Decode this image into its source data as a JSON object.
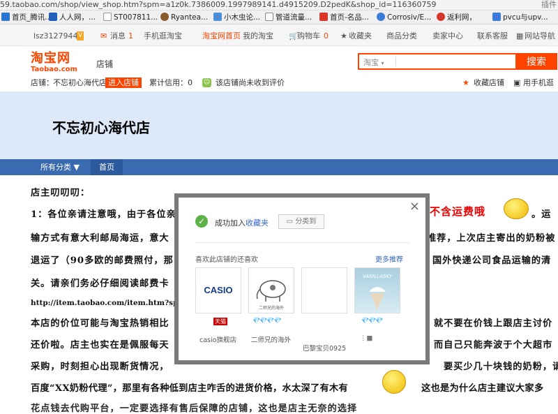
{
  "browser": {
    "url": "59.taobao.com/shop/view_shop.htm?spm=a1z0k.7386009.1997989141.d4915209.D2pedK&shop_id=116360759",
    "right_label": "插件"
  },
  "bookmarks": [
    {
      "label": "首页_腾讯...",
      "color": "#2e77d0"
    },
    {
      "label": "人人网，...",
      "color": "#1f5fb8"
    },
    {
      "label": "ST007811...",
      "color": "#999999"
    },
    {
      "label": "Ryantea...",
      "color": "#8b5a2b"
    },
    {
      "label": "小木虫论...",
      "color": "#4a8fd6"
    },
    {
      "label": "管道流量...",
      "color": "#888888"
    },
    {
      "label": "首页-名品...",
      "color": "#d9362b"
    },
    {
      "label": "Corrosiv/E...",
      "color": "#3a7bd5"
    },
    {
      "label": "返利网，",
      "color": "#d9362b"
    },
    {
      "label": "pvcu与upv...",
      "color": "#3a7bd5"
    }
  ],
  "topbar": {
    "username": "lsz31279447",
    "vip": "V",
    "messages": "消息",
    "msg_count": "1",
    "mobile": "手机逛淘宝",
    "home": "淘宝网首页",
    "my_taobao": "我的淘宝",
    "cart": "购物车",
    "cart_count": "0",
    "favorites": "收藏夹",
    "categories": "商品分类",
    "seller": "卖家中心",
    "service": "联系客服",
    "sitemap": "网站导航"
  },
  "header": {
    "logo_cn": "淘宝网",
    "logo_en": "Taobao.com",
    "shop_label": "店铺",
    "search_scope": "淘宝",
    "search_button": "搜索"
  },
  "shoprow": {
    "shop_prefix": "店铺：",
    "shop_name": "不忘初心海代店",
    "enter_shop": "进入店铺",
    "credit": "累计信用：0",
    "no_reviews": "该店铺尚未收到评价",
    "fav_shop": "收藏店铺",
    "mobile_shop": "用手机逛"
  },
  "banner": {
    "title": "不忘初心海代店"
  },
  "nav": {
    "all_categories": "所有分类",
    "home": "首页"
  },
  "content": {
    "line1": "店主叨叨叨：",
    "line2a": "1：各位亲请注意哦，由于各位亲",
    "line2_red": "不含运费哦",
    "line2b": "。运",
    "line3a": "输方式有意大利邮局海运，意大",
    "line3b": "推荐，上次店主寄出的奶粉被",
    "line4a": "退运了（90多欧的邮费照付，那",
    "line4b": "国外快递公司食品运输的清",
    "line5": "关。请亲们务必仔细阅读邮费卡",
    "line6": "http://item.taobao.com/item.htm?spm",
    "line7a": "本店的价位可能与淘宝热销相比",
    "line7b": "就不要在价钱上跟店主讨价",
    "line8a": "还价啦。店主也实在是佩服每天",
    "line8b": "而自己只能奔波于个大超市",
    "line9a": "采购，时刻担心出现断货情况，",
    "line9b": "要买少几十块钱的奶粉，请",
    "line10a": "百度“XX奶粉代理”，那里有各种低到店主咋舌的进货价格，水太深了有木有",
    "line10b": "这也是为什么店主建议大家多",
    "line11": "花点钱去代购平台，一定要选择有售后保障的店铺，这也是店主无奈的选择"
  },
  "modal": {
    "close": "×",
    "success_prefix": "成功加入",
    "success_link": "收藏夹",
    "category_btn": "分类到",
    "also_like": "喜欢此店铺的还喜欢",
    "more": "更多推荐",
    "shops": [
      {
        "logo_text": "CASIO",
        "name": "casio旗舰店",
        "badge": "天猫",
        "diamonds": ""
      },
      {
        "logo_text": "二师兄的海外",
        "name": "二师兄的海外",
        "badge": "",
        "diamonds": "💎💎💎💎"
      },
      {
        "logo_text": "",
        "name": "巴黎宝贝0925",
        "badge": "",
        "diamonds": ""
      },
      {
        "logo_text": "VANILLASKY",
        "name": "",
        "badge": "",
        "diamonds": "💎💎💎"
      }
    ]
  },
  "colors": {
    "accent": "#ff4400",
    "nav": "#3a6ab0",
    "banner": "#dde8f8",
    "link": "#3366cc"
  }
}
